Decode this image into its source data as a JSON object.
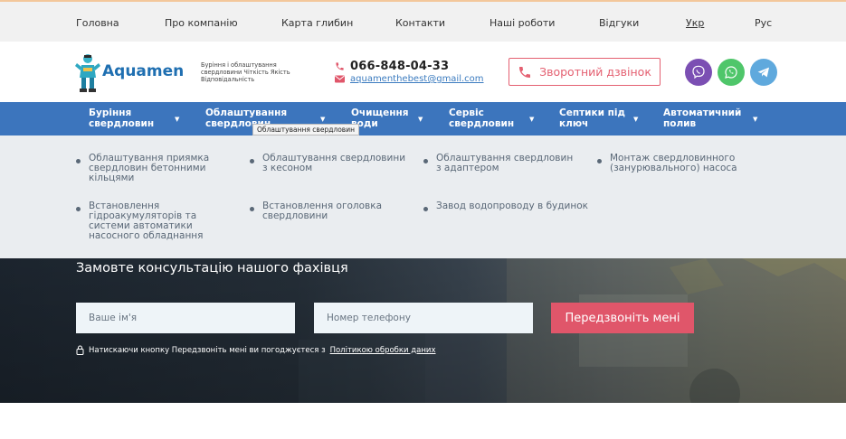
{
  "topnav": {
    "items": [
      {
        "label": "Головна"
      },
      {
        "label": "Про компанію"
      },
      {
        "label": "Карта глибин"
      },
      {
        "label": "Контакти"
      },
      {
        "label": "Наші роботи"
      },
      {
        "label": "Відгуки"
      },
      {
        "label": "Укр",
        "active": true
      },
      {
        "label": "Рус"
      }
    ]
  },
  "header": {
    "logo_text": "Aquamen",
    "tagline": "Буріння і облаштування свердловини Чіткість Якість Відповідальність",
    "phone": "066-848-04-33",
    "email": "aquamenthebest@gmail.com",
    "callback_label": "Зворотний дзвінок",
    "social": [
      "viber-icon",
      "whatsapp-icon",
      "telegram-icon"
    ]
  },
  "mainnav": {
    "items": [
      {
        "label": "Буріння свердловин"
      },
      {
        "label": "Облаштування свердловин"
      },
      {
        "label": "Очищення води"
      },
      {
        "label": "Сервіс свердловин"
      },
      {
        "label": "Септики під ключ"
      },
      {
        "label": "Автоматичний полив"
      }
    ],
    "tooltip": "Облаштування свердловин"
  },
  "submenu": {
    "items": [
      {
        "label": "Облаштування приямка свердловин бетонними кільцями"
      },
      {
        "label": "Облаштування свердловини з кесоном"
      },
      {
        "label": "Облаштування свердловин з адаптером"
      },
      {
        "label": "Монтаж свердловинного (занурювального) насоса"
      },
      {
        "label": "Встановлення гідроакумуляторів та системи автоматики насосного обладнання"
      },
      {
        "label": "Встановлення оголовка свердловини"
      },
      {
        "label": "Завод водопроводу в будинок"
      }
    ]
  },
  "consult": {
    "title": "Замовте консультацію нашого фахівця",
    "name_placeholder": "Ваше ім'я",
    "phone_placeholder": "Номер телефону",
    "submit_label": "Передзвоніть мені",
    "consent_text": "Натискаючи кнопку Передзвоніть мені ви погоджуєтеся з",
    "consent_link": "Політикою обробки даних"
  },
  "colors": {
    "accent_blue": "#3c75bd",
    "accent_red": "#e0566a",
    "topbar_bg": "#f1f1f1",
    "submenu_bg": "#eaedf0"
  }
}
